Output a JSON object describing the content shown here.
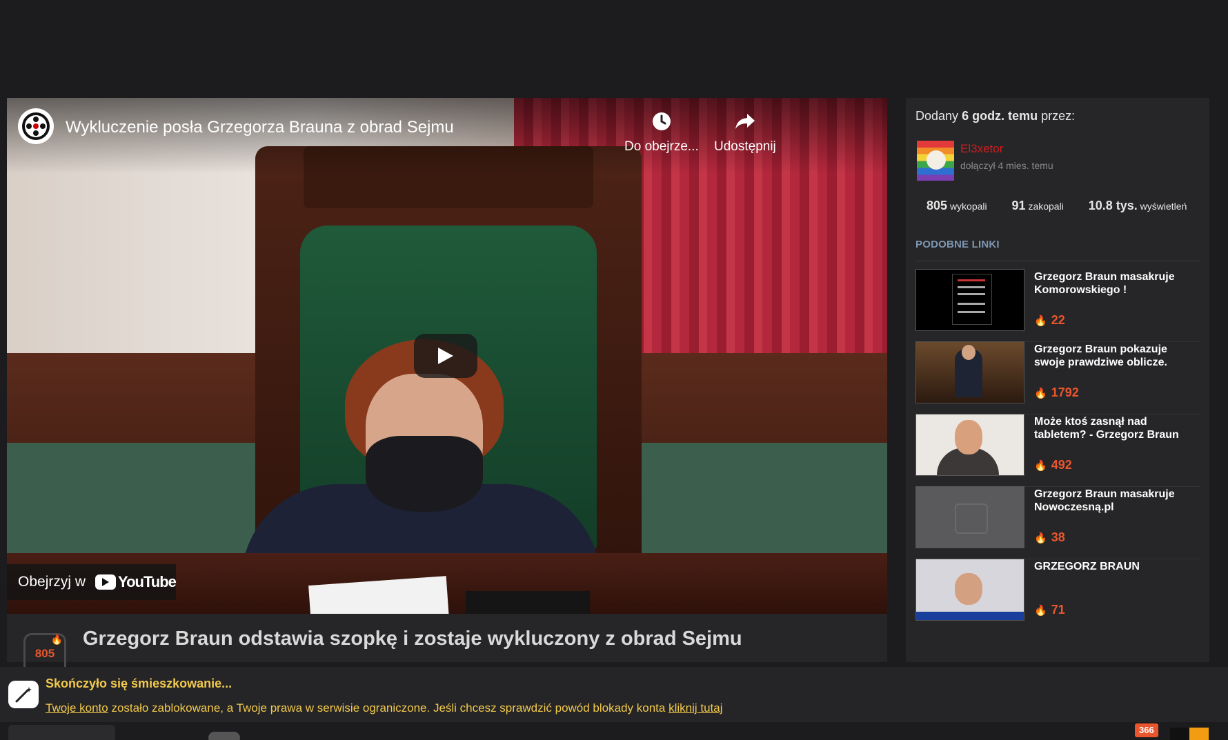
{
  "video": {
    "title": "Wykluczenie posła Grzegorza Brauna z obrad Sejmu",
    "watch_later_label": "Do obejrze...",
    "share_label": "Udostępnij",
    "watch_on_label": "Obejrzyj w",
    "youtube_label": "YouTube"
  },
  "link": {
    "vote_count": "805",
    "title": "Grzegorz Braun odstawia szopkę i zostaje wykluczony z obrad Sejmu"
  },
  "added": {
    "prefix": "Dodany",
    "time": "6 godz. temu",
    "suffix": "przez:",
    "username": "El3xetor",
    "joined": "dołączył 4 mies. temu",
    "stats": [
      {
        "value": "805",
        "label": "wykopali"
      },
      {
        "value": "91",
        "label": "zakopali"
      },
      {
        "value": "10.8 tys.",
        "label": "wyświetleń"
      }
    ]
  },
  "similar": {
    "heading": "PODOBNE LINKI",
    "items": [
      {
        "title": "Grzegorz Braun masakruje Komorowskiego !",
        "count": "22"
      },
      {
        "title": "Grzegorz Braun pokazuje swoje prawdziwe oblicze.",
        "count": "1792"
      },
      {
        "title": "Może ktoś zasnął nad tabletem? - Grzegorz Braun",
        "count": "492"
      },
      {
        "title": "Grzegorz Braun masakruje Nowoczesną.pl",
        "count": "38"
      },
      {
        "title": "GRZEGORZ BRAUN",
        "count": "71"
      }
    ]
  },
  "notice": {
    "heading": "Skończyło się śmieszkowanie...",
    "link1": "Twoje konto",
    "message": " zostało zablokowane, a Twoje prawa w serwisie ograniczone. Jeśli chcesz sprawdzić powód blokady konta ",
    "link2": "kliknij tutaj"
  },
  "bottomnav": {
    "notif_count": "366"
  },
  "colors": {
    "accent": "#e9562e",
    "username": "#d11d1d",
    "notice_text": "#f2c94c",
    "section_heading": "#7f97b4"
  }
}
